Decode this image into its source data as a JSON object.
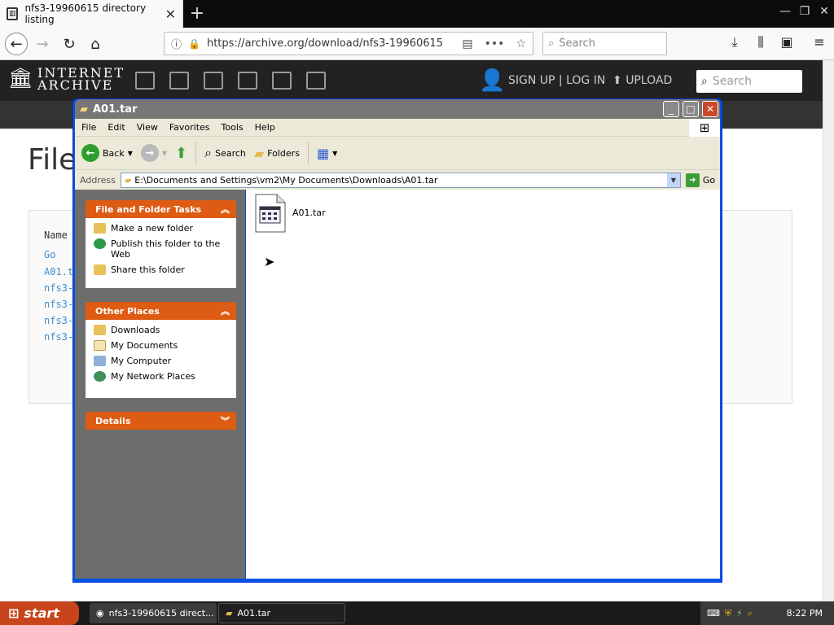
{
  "browser": {
    "tab_title": "nfs3-19960615 directory listing",
    "tab_close": "✕",
    "new_tab": "+",
    "url": "https://archive.org/download/nfs3-19960615",
    "search_placeholder": "Search"
  },
  "ia": {
    "logo_line1": "INTERNET",
    "logo_line2": "ARCHIVE",
    "signup_login": "SIGN UP | LOG IN",
    "upload": "UPLOAD",
    "search_placeholder": "Search"
  },
  "page": {
    "title": "File",
    "col_name": "Name",
    "rows": [
      "Go",
      "A01.t",
      "nfs3-",
      "nfs3-",
      "nfs3-",
      "nfs3-"
    ]
  },
  "explorer": {
    "title": "A01.tar",
    "menu": [
      "File",
      "Edit",
      "View",
      "Favorites",
      "Tools",
      "Help"
    ],
    "toolbar": {
      "back": "Back",
      "search": "Search",
      "folders": "Folders"
    },
    "address_label": "Address",
    "address": "E:\\Documents and Settings\\vm2\\My Documents\\Downloads\\A01.tar",
    "go": "Go",
    "tasks_header": "File and Folder Tasks",
    "tasks": [
      "Make a new folder",
      "Publish this folder to the Web",
      "Share this folder"
    ],
    "places_header": "Other Places",
    "places": [
      "Downloads",
      "My Documents",
      "My Computer",
      "My Network Places"
    ],
    "details_header": "Details",
    "file": "A01.tar"
  },
  "taskbar": {
    "start": "start",
    "tasks": [
      "nfs3-19960615 direct...",
      "A01.tar"
    ],
    "clock": "8:22 PM"
  },
  "colors": {
    "accent_orange": "#dd5b13",
    "xp_blue": "#0054e3",
    "start_red": "#c8451c"
  }
}
